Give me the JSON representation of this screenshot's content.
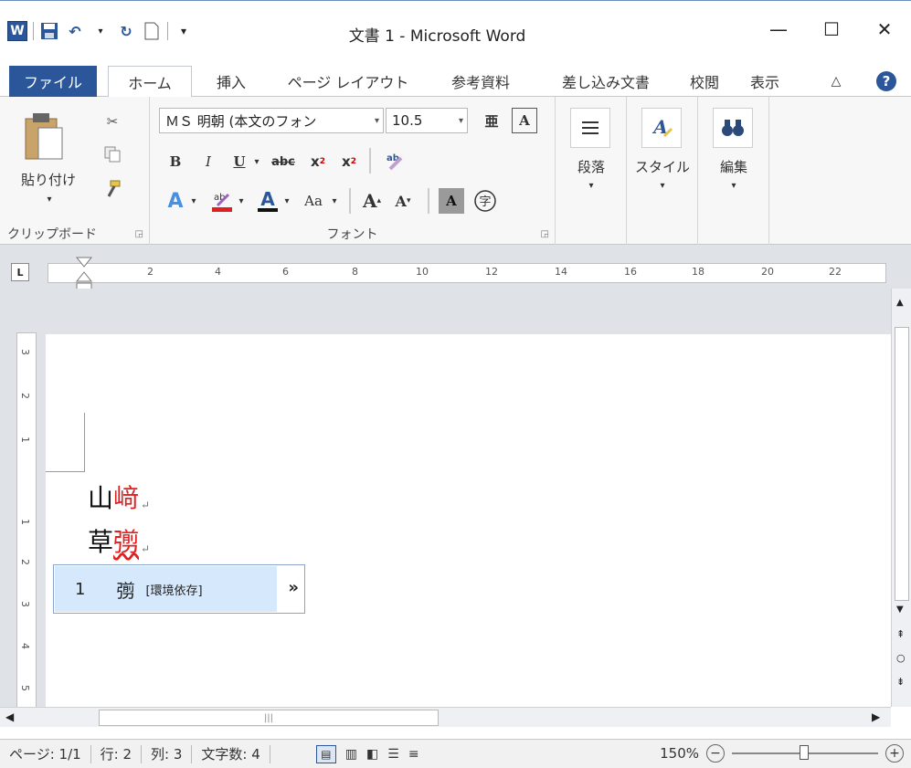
{
  "window": {
    "title": "文書 1 - Microsoft Word",
    "app_icon_letter": "W",
    "min_symbol": "—",
    "max_symbol": "☐",
    "close_symbol": "✕"
  },
  "tabs": {
    "file": "ファイル",
    "home": "ホーム",
    "insert": "挿入",
    "page_layout": "ページ レイアウト",
    "references": "参考資料",
    "mailings": "差し込み文書",
    "review": "校閲",
    "view": "表示"
  },
  "ribbon": {
    "clipboard": {
      "paste_label": "貼り付け",
      "group_label": "クリップボード"
    },
    "font": {
      "font_name": "ＭＳ 明朝 (本文のフォン",
      "font_size": "10.5",
      "group_label": "フォント"
    },
    "paragraph_label": "段落",
    "styles_label": "スタイル",
    "editing_label": "編集"
  },
  "ruler": {
    "h_marks": [
      "2",
      "4",
      "6",
      "8",
      "10",
      "12",
      "14",
      "16",
      "18",
      "20",
      "22"
    ],
    "v_marks": [
      "3",
      "2",
      "1",
      "1",
      "2",
      "3",
      "4",
      "5"
    ]
  },
  "document": {
    "line1_base": "山",
    "line1_red": "﨑",
    "line2_base": "草",
    "line2_red": "彅",
    "return_mark": "↵"
  },
  "ime": {
    "index": "1",
    "candidate": "彅",
    "note": "[環境依存]",
    "more": "»"
  },
  "status": {
    "page": "ページ: 1/1",
    "line": "行: 2",
    "column": "列: 3",
    "word_count": "文字数: 4",
    "zoom": "150%"
  }
}
